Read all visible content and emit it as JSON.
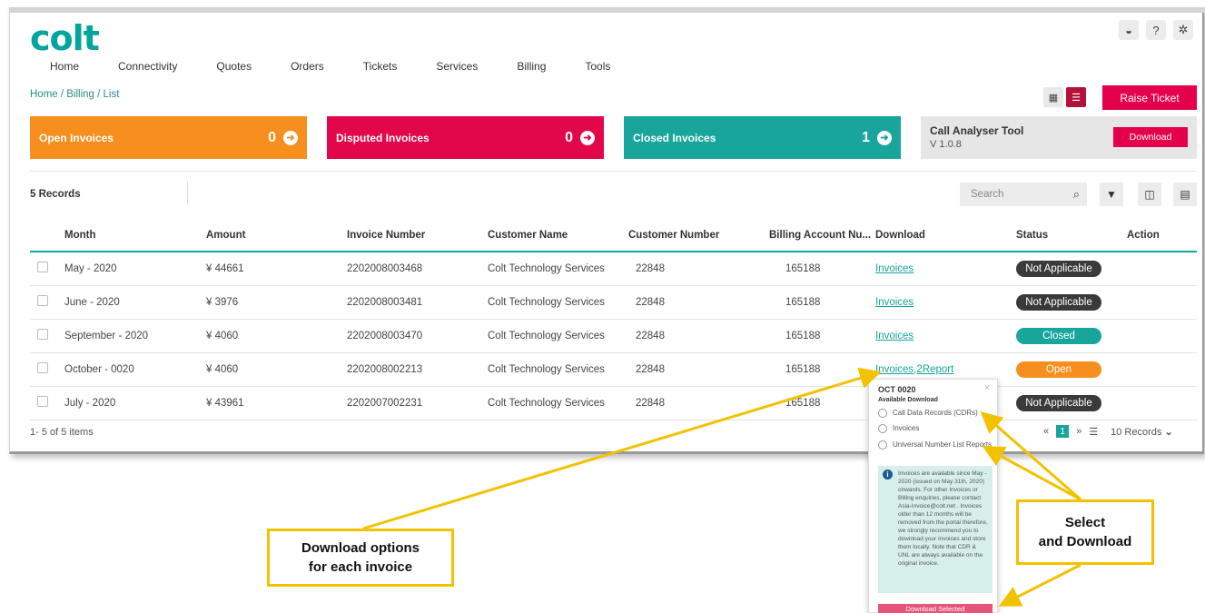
{
  "app": {
    "logo": "colt",
    "top_icons": [
      "globe-icon",
      "help-icon",
      "settings-icon"
    ],
    "top_icon_glyphs": [
      "◒",
      "?",
      "✲"
    ]
  },
  "nav": [
    "Home",
    "Connectivity",
    "Quotes",
    "Orders",
    "Tickets",
    "Services",
    "Billing",
    "Tools"
  ],
  "breadcrumb": "Home / Billing / List",
  "toolbar": {
    "raise_ticket": "Raise Ticket"
  },
  "cards": {
    "open": {
      "label": "Open Invoices",
      "count": "0"
    },
    "disputed": {
      "label": "Disputed Invoices",
      "count": "0"
    },
    "closed": {
      "label": "Closed Invoices",
      "count": "1"
    },
    "analyser": {
      "title": "Call Analyser Tool",
      "version": "V 1.0.8",
      "download": "Download"
    }
  },
  "records_label": "5 Records",
  "search": {
    "placeholder": "Search"
  },
  "table": {
    "headers": [
      "Month",
      "Amount",
      "Invoice Number",
      "Customer Name",
      "Customer Number",
      "Billing Account Nu...",
      "Download",
      "Status",
      "Action"
    ],
    "rows": [
      {
        "month": "May - 2020",
        "amount": "¥ 44661",
        "invoice": "2202008003468",
        "customer": "Colt Technology Services",
        "cust_no": "22848",
        "billing": "165188",
        "download": "Invoices",
        "status": "Not Applicable",
        "status_type": "na"
      },
      {
        "month": "June - 2020",
        "amount": "¥ 3976",
        "invoice": "2202008003481",
        "customer": "Colt Technology Services",
        "cust_no": "22848",
        "billing": "165188",
        "download": "Invoices",
        "status": "Not Applicable",
        "status_type": "na"
      },
      {
        "month": "September - 2020",
        "amount": "¥ 4060",
        "invoice": "2202008003470",
        "customer": "Colt Technology Services",
        "cust_no": "22848",
        "billing": "165188",
        "download": "Invoices",
        "status": "Closed",
        "status_type": "closed"
      },
      {
        "month": "October - 0020",
        "amount": "¥ 4060",
        "invoice": "2202008002213",
        "customer": "Colt Technology Services",
        "cust_no": "22848",
        "billing": "165188",
        "download": "Invoices,2Report",
        "status": "Open",
        "status_type": "open"
      },
      {
        "month": "July - 2020",
        "amount": "¥ 43961",
        "invoice": "2202007002231",
        "customer": "Colt Technology Services",
        "cust_no": "22848",
        "billing": "165188",
        "download": "",
        "status": "Not Applicable",
        "status_type": "na"
      }
    ]
  },
  "footer": {
    "items": "1- 5 of 5 items",
    "pager": {
      "first": "«",
      "current": "1",
      "last": "»",
      "page_size": "10 Records"
    }
  },
  "popover": {
    "title": "OCT 0020",
    "close": "×",
    "subtitle": "Available Download",
    "options": [
      "Call Data Records (CDRs)",
      "Invoices",
      "Universal Number List Reports"
    ],
    "info": "Invoices are available since May - 2020 (issued on May 31th, 2020) onwards. For other Invoices or Billing enquiries, please contact Asia-Invoice@colt.net . Invoices older than 12 months will be removed from the portal therefore, we strongly recommend you to download your invoices and store them locally. Note that CDR & UNL are always available on the original invoice.",
    "download_button": "Download Selected"
  },
  "callouts": {
    "download_options": [
      "Download options",
      "for each invoice"
    ],
    "select_download": [
      "Select",
      "and Download"
    ]
  },
  "colors": {
    "brand": "#00a59b",
    "open": "#f78f1e",
    "disputed": "#e2064a",
    "closed": "#17a59c",
    "annotation": "#f2c200"
  }
}
